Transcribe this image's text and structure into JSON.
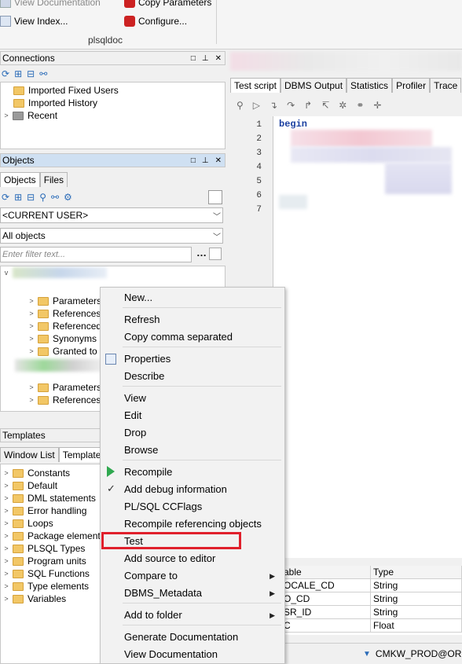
{
  "ribbon": {
    "view_documentation": "View Documentation",
    "view_index": "View Index...",
    "copy_parameters": "Copy Parameters",
    "configure": "Configure...",
    "group_label": "plsqldoc"
  },
  "connections": {
    "title": "Connections",
    "items": [
      "Imported Fixed Users",
      "Imported History",
      "Recent"
    ]
  },
  "objects": {
    "title": "Objects",
    "tabs": [
      "Objects",
      "Files"
    ],
    "user_combo": "<CURRENT USER>",
    "filter_combo": "All objects",
    "filter_placeholder": "Enter filter text...",
    "tree_items_a": [
      "Parameters",
      "References",
      "Referenced",
      "Synonyms",
      "Granted to"
    ],
    "tree_items_b": [
      "Parameters",
      "References"
    ]
  },
  "templates": {
    "title": "Templates",
    "tabs": [
      "Window List",
      "Templates"
    ],
    "items": [
      "Constants",
      "Default",
      "DML statements",
      "Error handling",
      "Loops",
      "Package elements",
      "PLSQL Types",
      "Program units",
      "SQL Functions",
      "Type elements",
      "Variables"
    ]
  },
  "editor": {
    "tabs": [
      "Test script",
      "DBMS Output",
      "Statistics",
      "Profiler",
      "Trace"
    ],
    "line_numbers": [
      "1",
      "2",
      "3",
      "4",
      "5",
      "6",
      "7"
    ],
    "first_keyword": "begin"
  },
  "context_menu": {
    "items": [
      "New...",
      "Refresh",
      "Copy comma separated",
      "Properties",
      "Describe",
      "View",
      "Edit",
      "Drop",
      "Browse",
      "Recompile",
      "Add debug information",
      "PL/SQL CCFlags",
      "Recompile referencing objects",
      "Test",
      "Add source to editor",
      "Compare to",
      "DBMS_Metadata",
      "Add to folder",
      "Generate Documentation",
      "View Documentation"
    ],
    "highlighted": "Test"
  },
  "var_grid": {
    "headers": [
      "able",
      "Type"
    ],
    "rows": [
      [
        "OCALE_CD",
        "String"
      ],
      [
        "O_CD",
        "String"
      ],
      [
        "SR_ID",
        "String"
      ],
      [
        "C",
        "Float"
      ]
    ]
  },
  "status": {
    "connection": "CMKW_PROD@ORC"
  },
  "colors": {
    "highlight_border": "#e0202c",
    "panel_active": "#cfe0f2",
    "run_green": "#2fa84f"
  }
}
